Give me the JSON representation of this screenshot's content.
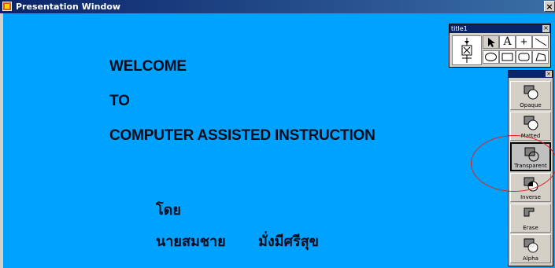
{
  "window": {
    "title": "Presentation Window",
    "close_label": "×"
  },
  "stage": {
    "lines": [
      "WELCOME",
      "TO",
      "COMPUTER ASSISTED INSTRUCTION"
    ],
    "by_label": "โดย",
    "author_first": "นายสมชาย",
    "author_last": "มั่งมีศรีสุข",
    "background_color": "#00a2ff"
  },
  "tool_palette": {
    "title": "title1",
    "close_label": "×",
    "tools": [
      "arrow-tool",
      "text-tool",
      "crosshair-tool",
      "line-tool",
      "oval-tool",
      "rectangle-tool",
      "rounded-rectangle-tool",
      "polygon-tool"
    ],
    "text_tool_glyph": "A",
    "crosshair_glyph": "+"
  },
  "ink_panel": {
    "close_label": "×",
    "modes": [
      {
        "label": "Opaque"
      },
      {
        "label": "Matted"
      },
      {
        "label": "Transparent",
        "selected": true
      },
      {
        "label": "Inverse"
      },
      {
        "label": "Erase"
      },
      {
        "label": "Alpha"
      }
    ],
    "highlight_color": "#e02020"
  }
}
